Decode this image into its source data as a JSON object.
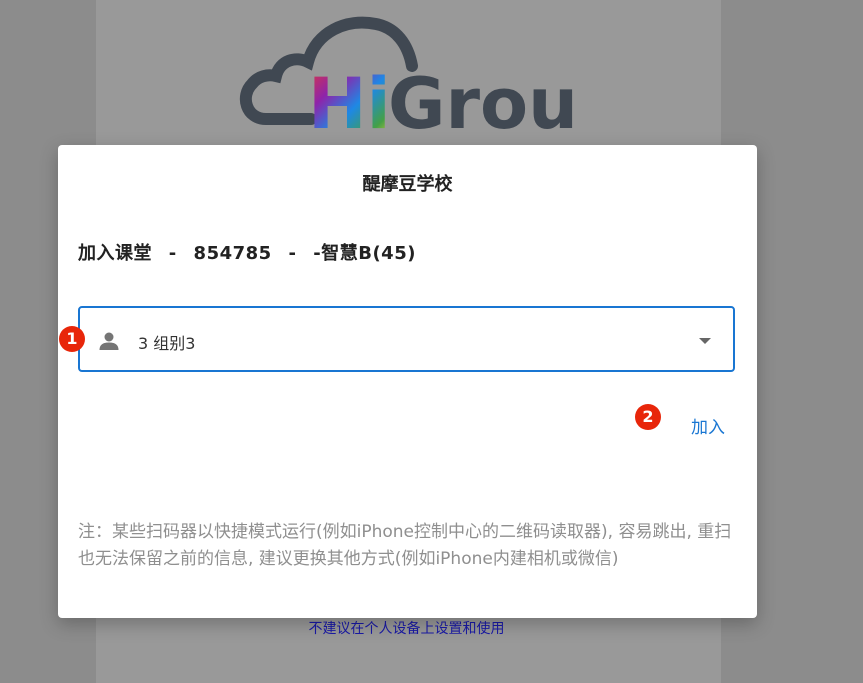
{
  "logo": {
    "text_hi": "Hi",
    "text_group": "Group",
    "colors": {
      "outline": "#404852",
      "hi_gradient": [
        "#e53935",
        "#8e24aa",
        "#1e88e5",
        "#43a047",
        "#fdd835"
      ]
    }
  },
  "dialog": {
    "title": "醍摩豆学校",
    "class_line": {
      "label": "加入课堂",
      "separator1": "-",
      "code": "854785",
      "separator2": "-",
      "class_name": "-智慧B(45)"
    },
    "group_select": {
      "icon": "person-icon",
      "selected_value": "3 组别3"
    },
    "join_button_label": "加入",
    "note": "注：某些扫码器以快捷模式运行(例如iPhone控制中心的二维码读取器), 容易跳出, 重扫也无法保留之前的信息, 建议更换其他方式(例如iPhone内建相机或微信)"
  },
  "markers": [
    "1",
    "2"
  ],
  "bottom_link": "不建议在个人设备上设置和使用",
  "colors": {
    "accent": "#1976d2",
    "marker": "#e8260a",
    "overlay": "#8c8c8c",
    "link": "#1a1aa6"
  }
}
